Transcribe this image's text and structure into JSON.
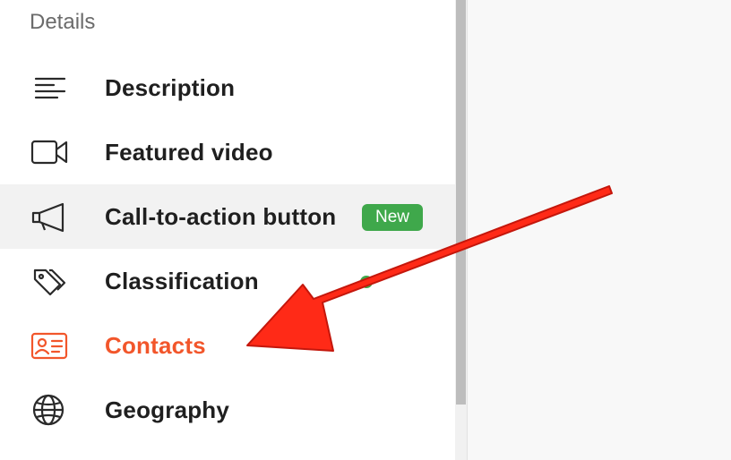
{
  "sidebar": {
    "section_title": "Details",
    "items": [
      {
        "label": "Description",
        "icon": "lines-icon"
      },
      {
        "label": "Featured video",
        "icon": "video-icon"
      },
      {
        "label": "Call-to-action button",
        "icon": "megaphone-icon",
        "badge": "New"
      },
      {
        "label": "Classification",
        "icon": "tags-icon"
      },
      {
        "label": "Contacts",
        "icon": "contact-card-icon"
      },
      {
        "label": "Geography",
        "icon": "globe-icon"
      }
    ]
  },
  "colors": {
    "accent": "#f2562b",
    "badge": "#3fa84b",
    "text": "#1f1f1f",
    "hover_bg": "#f2f2f2",
    "annotation_arrow": "#ff2a17"
  }
}
